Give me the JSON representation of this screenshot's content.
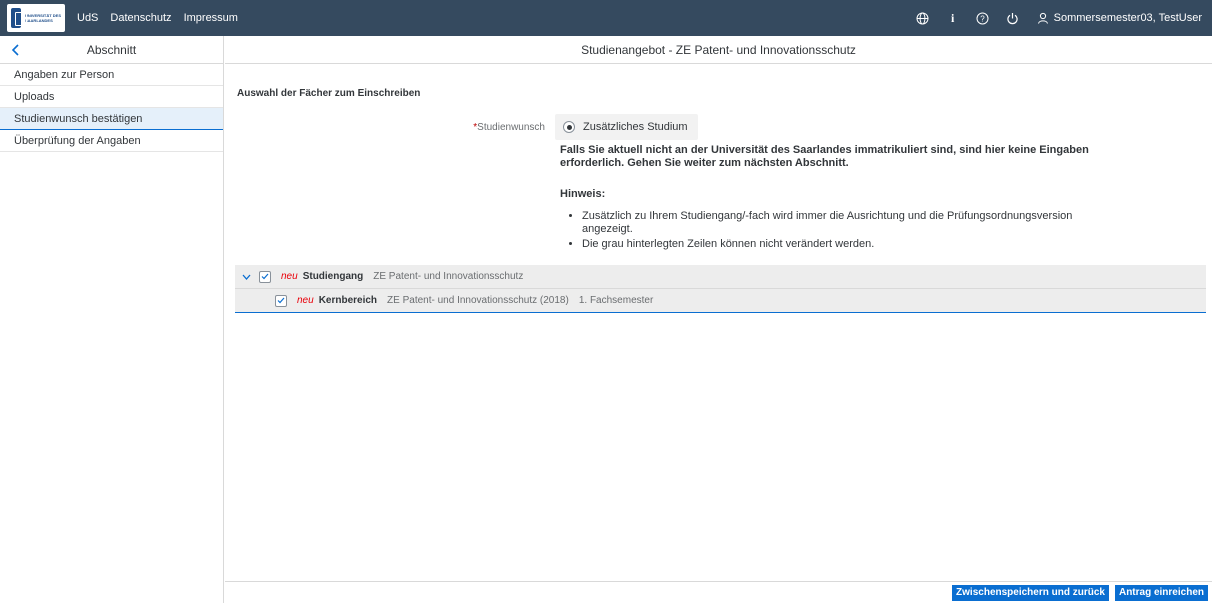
{
  "shell": {
    "logo_text": "UNIVERSITÄT DES SAARLANDES",
    "links": [
      "UdS",
      "Datenschutz",
      "Impressum"
    ],
    "user_label": "Sommersemester03, TestUser"
  },
  "left_panel": {
    "title": "Abschnitt",
    "items": [
      {
        "label": "Angaben zur Person"
      },
      {
        "label": "Uploads"
      },
      {
        "label": "Studienwunsch bestätigen"
      },
      {
        "label": "Überprüfung der Angaben"
      }
    ]
  },
  "main": {
    "title": "Studienangebot - ZE Patent- und Innovationsschutz",
    "section_title": "Auswahl der Fächer zum Einschreiben",
    "field_required": "*",
    "field_label": "Studienwunsch",
    "radio_label": "Zusätzliches Studium",
    "info_bold": "Falls Sie aktuell nicht an der Universität des Saarlandes immatrikuliert sind, sind hier keine Eingaben erforderlich. Gehen Sie weiter zum nächsten Abschnitt.",
    "hint_title": "Hinweis:",
    "hints": [
      "Zusätzlich zu Ihrem Studiengang/-fach wird immer die Ausrichtung und die Prüfungsordnungsversion angezeigt.",
      "Die grau hinterlegten Zeilen können nicht verändert werden."
    ],
    "tree": [
      {
        "tag": "neu",
        "kind": "Studiengang",
        "name": "ZE Patent- und Innovationsschutz",
        "extra": ""
      },
      {
        "tag": "neu",
        "kind": "Kernbereich",
        "name": "ZE Patent- und Innovationsschutz (2018)",
        "extra": "1. Fachsemester"
      }
    ]
  },
  "footer": {
    "save_back_label": "Zwischenspeichern und zurück",
    "submit_label": "Antrag einreichen"
  }
}
